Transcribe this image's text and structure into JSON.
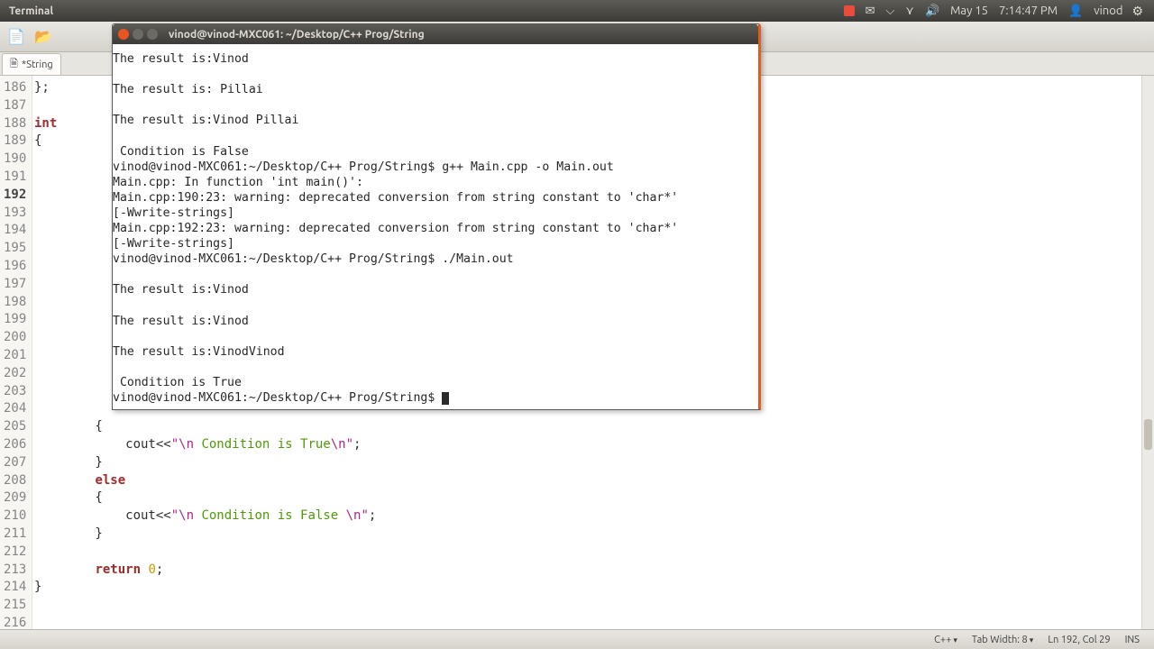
{
  "panel": {
    "title": "Terminal",
    "date": "May 15",
    "time": "7:14:47 PM",
    "user": "vinod"
  },
  "editor": {
    "tab_label": "*String",
    "status": {
      "row_count": "Ln 192, Col 29",
      "lang": "C++",
      "tab_width": "Tab Width: 8",
      "ins": "INS"
    },
    "lines": [
      {
        "n": 186,
        "plain": "};"
      },
      {
        "n": 187,
        "plain": ""
      },
      {
        "n": 188,
        "kw": "int"
      },
      {
        "n": 189,
        "plain": "{"
      },
      {
        "n": 190,
        "plain": ""
      },
      {
        "n": 191,
        "plain": ""
      },
      {
        "n": 192,
        "plain": "",
        "hl": true
      },
      {
        "n": 193,
        "plain": ""
      },
      {
        "n": 194,
        "plain": ""
      },
      {
        "n": 195,
        "plain": ""
      },
      {
        "n": 196,
        "plain": ""
      },
      {
        "n": 197,
        "plain": ""
      },
      {
        "n": 198,
        "plain": ""
      },
      {
        "n": 199,
        "plain": ""
      },
      {
        "n": 200,
        "plain": ""
      },
      {
        "n": 201,
        "plain": ""
      },
      {
        "n": 202,
        "plain": ""
      },
      {
        "n": 203,
        "plain": ""
      },
      {
        "n": 204,
        "plain": ""
      },
      {
        "n": 205,
        "plain": "        {"
      },
      {
        "n": 206
      },
      {
        "n": 207,
        "plain": "        }"
      },
      {
        "n": 208,
        "kw2": "else"
      },
      {
        "n": 209,
        "plain": "        {"
      },
      {
        "n": 210
      },
      {
        "n": 211,
        "plain": "        }"
      },
      {
        "n": 212,
        "plain": ""
      },
      {
        "n": 213,
        "ret": true
      },
      {
        "n": 214,
        "plain": "}"
      },
      {
        "n": 215,
        "plain": ""
      },
      {
        "n": 216,
        "plain": ""
      }
    ],
    "line206": {
      "pre": "            cout<<",
      "s1": "\"\\n ",
      "mid": "Condition is True",
      "s2": "\\n\"",
      "post": ";"
    },
    "line210": {
      "pre": "            cout<<",
      "s1": "\"\\n ",
      "mid": "Condition is False ",
      "s2": "\\n\"",
      "post": ";"
    },
    "line213": {
      "ret": "return",
      "zero": "0",
      "post": ";"
    }
  },
  "terminal": {
    "title": "vinod@vinod-MXC061: ~/Desktop/C++ Prog/String",
    "content": "The result is:Vinod\n\nThe result is: Pillai\n\nThe result is:Vinod Pillai\n\n Condition is False\nvinod@vinod-MXC061:~/Desktop/C++ Prog/String$ g++ Main.cpp -o Main.out\nMain.cpp: In function 'int main()':\nMain.cpp:190:23: warning: deprecated conversion from string constant to 'char*'\n[-Wwrite-strings]\nMain.cpp:192:23: warning: deprecated conversion from string constant to 'char*'\n[-Wwrite-strings]\nvinod@vinod-MXC061:~/Desktop/C++ Prog/String$ ./Main.out\n\nThe result is:Vinod\n\nThe result is:Vinod\n\nThe result is:VinodVinod\n\n Condition is True\nvinod@vinod-MXC061:~/Desktop/C++ Prog/String$ "
  }
}
